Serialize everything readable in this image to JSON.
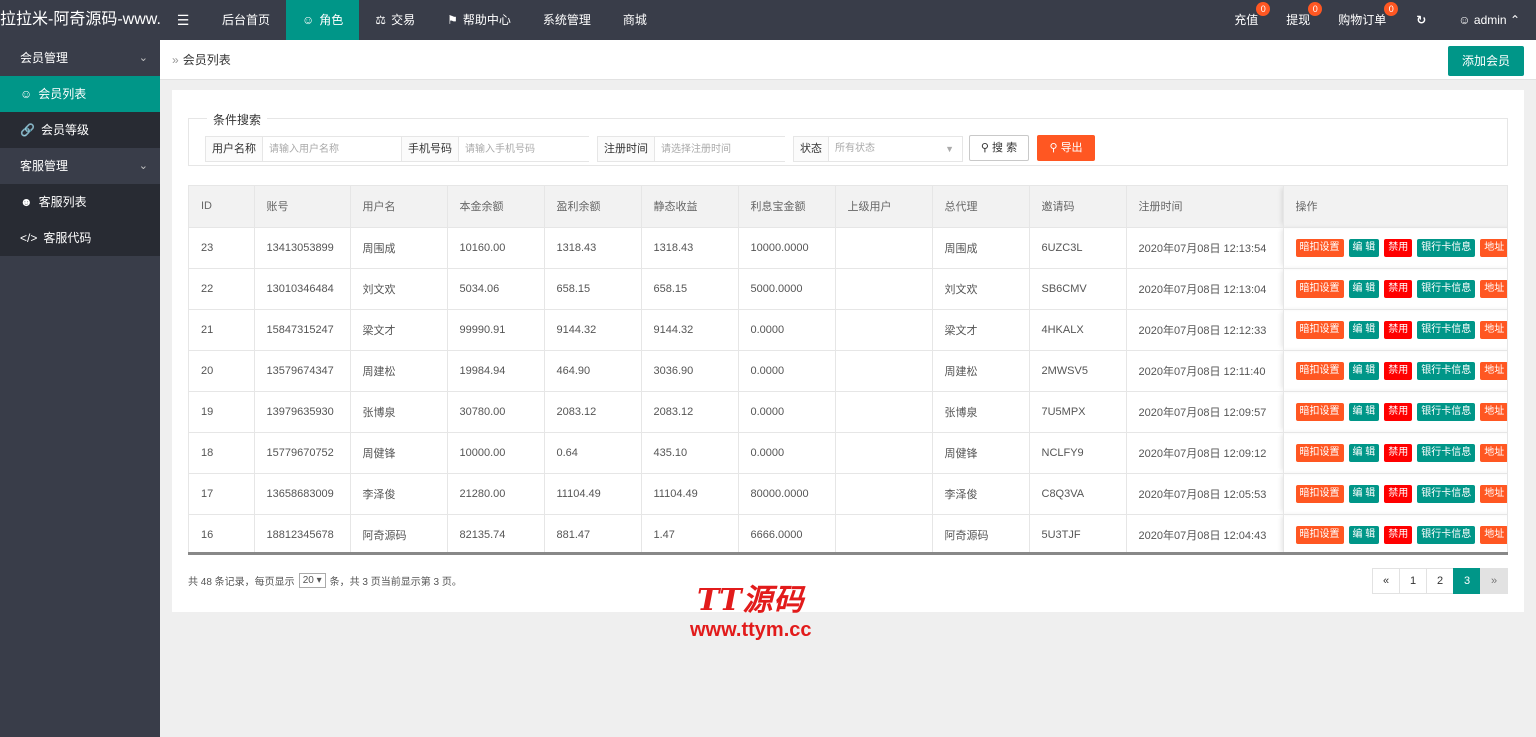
{
  "header": {
    "brand": "拉拉米-阿奇源码-www...",
    "menu_icon": "menu-icon",
    "nav": [
      {
        "label": "后台首页",
        "icon": ""
      },
      {
        "label": "角色",
        "icon": "user-icon"
      },
      {
        "label": "交易",
        "icon": "scale-icon"
      },
      {
        "label": "帮助中心",
        "icon": "flag-icon"
      },
      {
        "label": "系统管理",
        "icon": ""
      },
      {
        "label": "商城",
        "icon": ""
      }
    ],
    "right": [
      {
        "label": "充值",
        "badge": "0"
      },
      {
        "label": "提现",
        "badge": "0"
      },
      {
        "label": "购物订单",
        "badge": "0"
      }
    ],
    "refresh_icon": "refresh-icon",
    "user": "admin"
  },
  "sidebar": {
    "groups": [
      {
        "label": "会员管理",
        "items": [
          {
            "label": "会员列表",
            "icon": "user-icon",
            "active": true
          },
          {
            "label": "会员等级",
            "icon": "link-icon",
            "active": false
          }
        ]
      },
      {
        "label": "客服管理",
        "items": [
          {
            "label": "客服列表",
            "icon": "users-icon",
            "active": false
          },
          {
            "label": "客服代码",
            "icon": "code-icon",
            "active": false
          }
        ]
      }
    ]
  },
  "breadcrumb": {
    "current": "会员列表"
  },
  "toolbar": {
    "add_label": "添加会员"
  },
  "search": {
    "legend": "条件搜索",
    "username_label": "用户名称",
    "username_placeholder": "请输入用户名称",
    "phone_label": "手机号码",
    "phone_placeholder": "请输入手机号码",
    "regtime_label": "注册时间",
    "regtime_placeholder": "请选择注册时间",
    "status_label": "状态",
    "status_value": "所有状态",
    "search_button": "搜 索",
    "export_button": "导出"
  },
  "table": {
    "columns": [
      "ID",
      "账号",
      "用户名",
      "本金余额",
      "盈利余额",
      "静态收益",
      "利息宝金额",
      "上级用户",
      "总代理",
      "邀请码",
      "注册时间",
      "操作"
    ],
    "rows": [
      [
        "23",
        "13413053899",
        "周围成",
        "10160.00",
        "1318.43",
        "1318.43",
        "10000.0000",
        "",
        "周围成",
        "6UZC3L",
        "2020年07月08日 12:13:54"
      ],
      [
        "22",
        "13010346484",
        "刘文欢",
        "5034.06",
        "658.15",
        "658.15",
        "5000.0000",
        "",
        "刘文欢",
        "SB6CMV",
        "2020年07月08日 12:13:04"
      ],
      [
        "21",
        "15847315247",
        "梁文才",
        "99990.91",
        "9144.32",
        "9144.32",
        "0.0000",
        "",
        "梁文才",
        "4HKALX",
        "2020年07月08日 12:12:33"
      ],
      [
        "20",
        "13579674347",
        "周建松",
        "19984.94",
        "464.90",
        "3036.90",
        "0.0000",
        "",
        "周建松",
        "2MWSV5",
        "2020年07月08日 12:11:40"
      ],
      [
        "19",
        "13979635930",
        "张博泉",
        "30780.00",
        "2083.12",
        "2083.12",
        "0.0000",
        "",
        "张博泉",
        "7U5MPX",
        "2020年07月08日 12:09:57"
      ],
      [
        "18",
        "15779670752",
        "周健锋",
        "10000.00",
        "0.64",
        "435.10",
        "0.0000",
        "",
        "周健锋",
        "NCLFY9",
        "2020年07月08日 12:09:12"
      ],
      [
        "17",
        "13658683009",
        "李泽俊",
        "21280.00",
        "11104.49",
        "11104.49",
        "80000.0000",
        "",
        "李泽俊",
        "C8Q3VA",
        "2020年07月08日 12:05:53"
      ],
      [
        "16",
        "18812345678",
        "阿奇源码",
        "82135.74",
        "881.47",
        "1.47",
        "6666.0000",
        "",
        "阿奇源码",
        "5U3TJF",
        "2020年07月08日 12:04:43"
      ]
    ],
    "actions": [
      "暗扣设置",
      "编 辑",
      "禁用",
      "银行卡信息",
      "地址"
    ]
  },
  "pagination": {
    "prefix": "共 48 条记录，每页显示",
    "page_size": "20",
    "suffix": "条，共 3 页当前显示第 3 页。",
    "prev": "«",
    "pages": [
      "1",
      "2",
      "3"
    ],
    "current": "3",
    "next": "»"
  },
  "watermark": {
    "logo": "TT源码",
    "url": "www.ttym.cc"
  },
  "colors": {
    "primary": "#009688",
    "danger": "#ff5722",
    "red": "#ff0000",
    "header_bg": "#393d49"
  }
}
